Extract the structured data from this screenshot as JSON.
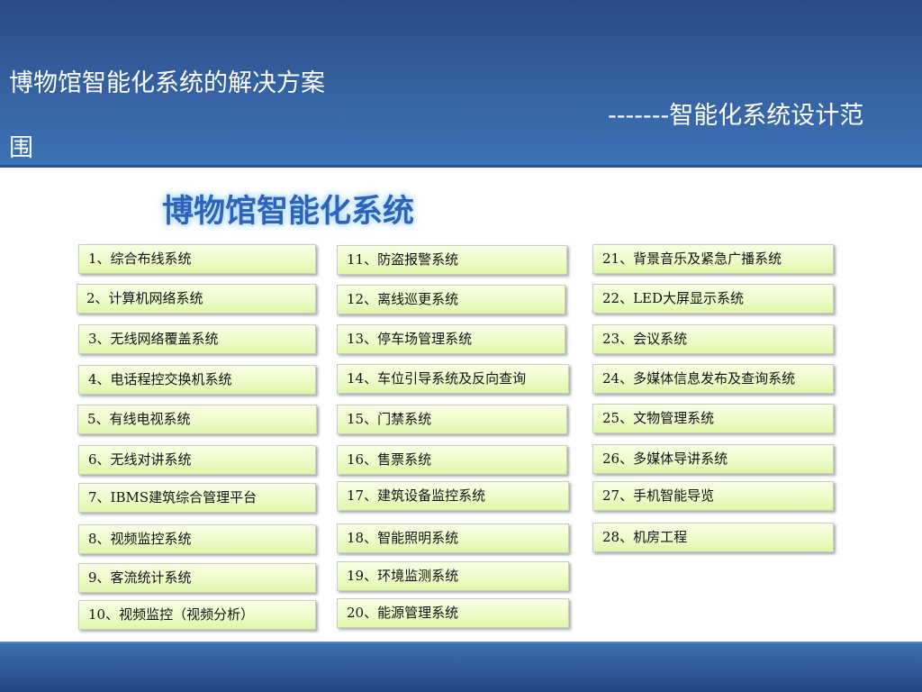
{
  "header": {
    "title_line1": "博物馆智能化系统的解决方案",
    "title_line2": "-------智能化系统设计范",
    "title_line3": "围"
  },
  "subtitle": "博物馆智能化系统",
  "columns": [
    [
      "1、综合布线系统",
      "2、计算机网络系统",
      "3、无线网络覆盖系统",
      "4、电话程控交换机系统",
      "5、有线电视系统",
      "6、无线对讲系统",
      "7、IBMS建筑综合管理平台",
      "8、视频监控系统",
      "9、客流统计系统",
      "10、视频监控（视频分析）"
    ],
    [
      "11、防盗报警系统",
      "12、离线巡更系统",
      "13、停车场管理系统",
      "14、车位引导系统及反向查询",
      "15、门禁系统",
      "16、售票系统",
      "17、建筑设备监控系统",
      "18、智能照明系统",
      "19、环境监测系统",
      "20、能源管理系统"
    ],
    [
      "21、背景音乐及紧急广播系统",
      "22、LED大屏显示系统",
      "23、会议系统",
      "24、多媒体信息发布及查询系统",
      "25、文物管理系统",
      "26、多媒体导讲系统",
      "27、手机智能导览",
      "28、机房工程"
    ]
  ]
}
